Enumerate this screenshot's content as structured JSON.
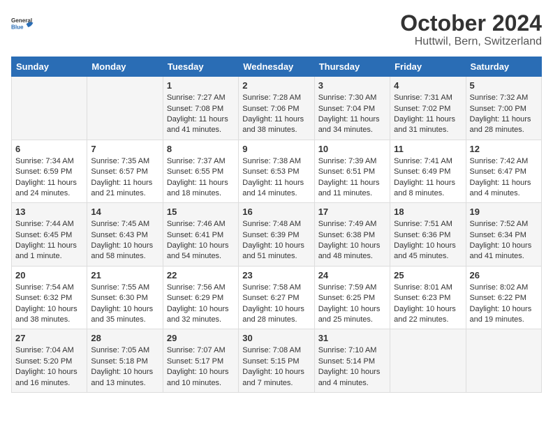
{
  "logo": {
    "text_general": "General",
    "text_blue": "Blue"
  },
  "title": "October 2024",
  "subtitle": "Huttwil, Bern, Switzerland",
  "days_of_week": [
    "Sunday",
    "Monday",
    "Tuesday",
    "Wednesday",
    "Thursday",
    "Friday",
    "Saturday"
  ],
  "weeks": [
    [
      {
        "num": "",
        "sunrise": "",
        "sunset": "",
        "daylight": ""
      },
      {
        "num": "",
        "sunrise": "",
        "sunset": "",
        "daylight": ""
      },
      {
        "num": "1",
        "sunrise": "Sunrise: 7:27 AM",
        "sunset": "Sunset: 7:08 PM",
        "daylight": "Daylight: 11 hours and 41 minutes."
      },
      {
        "num": "2",
        "sunrise": "Sunrise: 7:28 AM",
        "sunset": "Sunset: 7:06 PM",
        "daylight": "Daylight: 11 hours and 38 minutes."
      },
      {
        "num": "3",
        "sunrise": "Sunrise: 7:30 AM",
        "sunset": "Sunset: 7:04 PM",
        "daylight": "Daylight: 11 hours and 34 minutes."
      },
      {
        "num": "4",
        "sunrise": "Sunrise: 7:31 AM",
        "sunset": "Sunset: 7:02 PM",
        "daylight": "Daylight: 11 hours and 31 minutes."
      },
      {
        "num": "5",
        "sunrise": "Sunrise: 7:32 AM",
        "sunset": "Sunset: 7:00 PM",
        "daylight": "Daylight: 11 hours and 28 minutes."
      }
    ],
    [
      {
        "num": "6",
        "sunrise": "Sunrise: 7:34 AM",
        "sunset": "Sunset: 6:59 PM",
        "daylight": "Daylight: 11 hours and 24 minutes."
      },
      {
        "num": "7",
        "sunrise": "Sunrise: 7:35 AM",
        "sunset": "Sunset: 6:57 PM",
        "daylight": "Daylight: 11 hours and 21 minutes."
      },
      {
        "num": "8",
        "sunrise": "Sunrise: 7:37 AM",
        "sunset": "Sunset: 6:55 PM",
        "daylight": "Daylight: 11 hours and 18 minutes."
      },
      {
        "num": "9",
        "sunrise": "Sunrise: 7:38 AM",
        "sunset": "Sunset: 6:53 PM",
        "daylight": "Daylight: 11 hours and 14 minutes."
      },
      {
        "num": "10",
        "sunrise": "Sunrise: 7:39 AM",
        "sunset": "Sunset: 6:51 PM",
        "daylight": "Daylight: 11 hours and 11 minutes."
      },
      {
        "num": "11",
        "sunrise": "Sunrise: 7:41 AM",
        "sunset": "Sunset: 6:49 PM",
        "daylight": "Daylight: 11 hours and 8 minutes."
      },
      {
        "num": "12",
        "sunrise": "Sunrise: 7:42 AM",
        "sunset": "Sunset: 6:47 PM",
        "daylight": "Daylight: 11 hours and 4 minutes."
      }
    ],
    [
      {
        "num": "13",
        "sunrise": "Sunrise: 7:44 AM",
        "sunset": "Sunset: 6:45 PM",
        "daylight": "Daylight: 11 hours and 1 minute."
      },
      {
        "num": "14",
        "sunrise": "Sunrise: 7:45 AM",
        "sunset": "Sunset: 6:43 PM",
        "daylight": "Daylight: 10 hours and 58 minutes."
      },
      {
        "num": "15",
        "sunrise": "Sunrise: 7:46 AM",
        "sunset": "Sunset: 6:41 PM",
        "daylight": "Daylight: 10 hours and 54 minutes."
      },
      {
        "num": "16",
        "sunrise": "Sunrise: 7:48 AM",
        "sunset": "Sunset: 6:39 PM",
        "daylight": "Daylight: 10 hours and 51 minutes."
      },
      {
        "num": "17",
        "sunrise": "Sunrise: 7:49 AM",
        "sunset": "Sunset: 6:38 PM",
        "daylight": "Daylight: 10 hours and 48 minutes."
      },
      {
        "num": "18",
        "sunrise": "Sunrise: 7:51 AM",
        "sunset": "Sunset: 6:36 PM",
        "daylight": "Daylight: 10 hours and 45 minutes."
      },
      {
        "num": "19",
        "sunrise": "Sunrise: 7:52 AM",
        "sunset": "Sunset: 6:34 PM",
        "daylight": "Daylight: 10 hours and 41 minutes."
      }
    ],
    [
      {
        "num": "20",
        "sunrise": "Sunrise: 7:54 AM",
        "sunset": "Sunset: 6:32 PM",
        "daylight": "Daylight: 10 hours and 38 minutes."
      },
      {
        "num": "21",
        "sunrise": "Sunrise: 7:55 AM",
        "sunset": "Sunset: 6:30 PM",
        "daylight": "Daylight: 10 hours and 35 minutes."
      },
      {
        "num": "22",
        "sunrise": "Sunrise: 7:56 AM",
        "sunset": "Sunset: 6:29 PM",
        "daylight": "Daylight: 10 hours and 32 minutes."
      },
      {
        "num": "23",
        "sunrise": "Sunrise: 7:58 AM",
        "sunset": "Sunset: 6:27 PM",
        "daylight": "Daylight: 10 hours and 28 minutes."
      },
      {
        "num": "24",
        "sunrise": "Sunrise: 7:59 AM",
        "sunset": "Sunset: 6:25 PM",
        "daylight": "Daylight: 10 hours and 25 minutes."
      },
      {
        "num": "25",
        "sunrise": "Sunrise: 8:01 AM",
        "sunset": "Sunset: 6:23 PM",
        "daylight": "Daylight: 10 hours and 22 minutes."
      },
      {
        "num": "26",
        "sunrise": "Sunrise: 8:02 AM",
        "sunset": "Sunset: 6:22 PM",
        "daylight": "Daylight: 10 hours and 19 minutes."
      }
    ],
    [
      {
        "num": "27",
        "sunrise": "Sunrise: 7:04 AM",
        "sunset": "Sunset: 5:20 PM",
        "daylight": "Daylight: 10 hours and 16 minutes."
      },
      {
        "num": "28",
        "sunrise": "Sunrise: 7:05 AM",
        "sunset": "Sunset: 5:18 PM",
        "daylight": "Daylight: 10 hours and 13 minutes."
      },
      {
        "num": "29",
        "sunrise": "Sunrise: 7:07 AM",
        "sunset": "Sunset: 5:17 PM",
        "daylight": "Daylight: 10 hours and 10 minutes."
      },
      {
        "num": "30",
        "sunrise": "Sunrise: 7:08 AM",
        "sunset": "Sunset: 5:15 PM",
        "daylight": "Daylight: 10 hours and 7 minutes."
      },
      {
        "num": "31",
        "sunrise": "Sunrise: 7:10 AM",
        "sunset": "Sunset: 5:14 PM",
        "daylight": "Daylight: 10 hours and 4 minutes."
      },
      {
        "num": "",
        "sunrise": "",
        "sunset": "",
        "daylight": ""
      },
      {
        "num": "",
        "sunrise": "",
        "sunset": "",
        "daylight": ""
      }
    ]
  ]
}
